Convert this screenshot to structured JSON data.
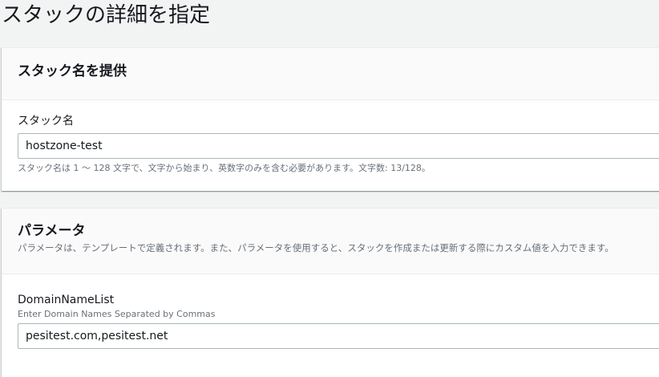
{
  "page": {
    "title": "スタックの詳細を指定"
  },
  "stack_name_panel": {
    "heading": "スタック名を提供",
    "field_label": "スタック名",
    "field_value": "hostzone-test",
    "constraint": "スタック名は 1 ～ 128 文字で、文字から始まり、英数字のみを含む必要があります。文字数: 13/128。"
  },
  "parameters_panel": {
    "heading": "パラメータ",
    "description": "パラメータは、テンプレートで定義されます。また、パラメータを使用すると、スタックを作成または更新する際にカスタム値を入力できます。",
    "params": [
      {
        "label": "DomainNameList",
        "description": "Enter Domain Names Separated by Commas",
        "value": "pesitest.com,pesitest.net"
      }
    ]
  }
}
